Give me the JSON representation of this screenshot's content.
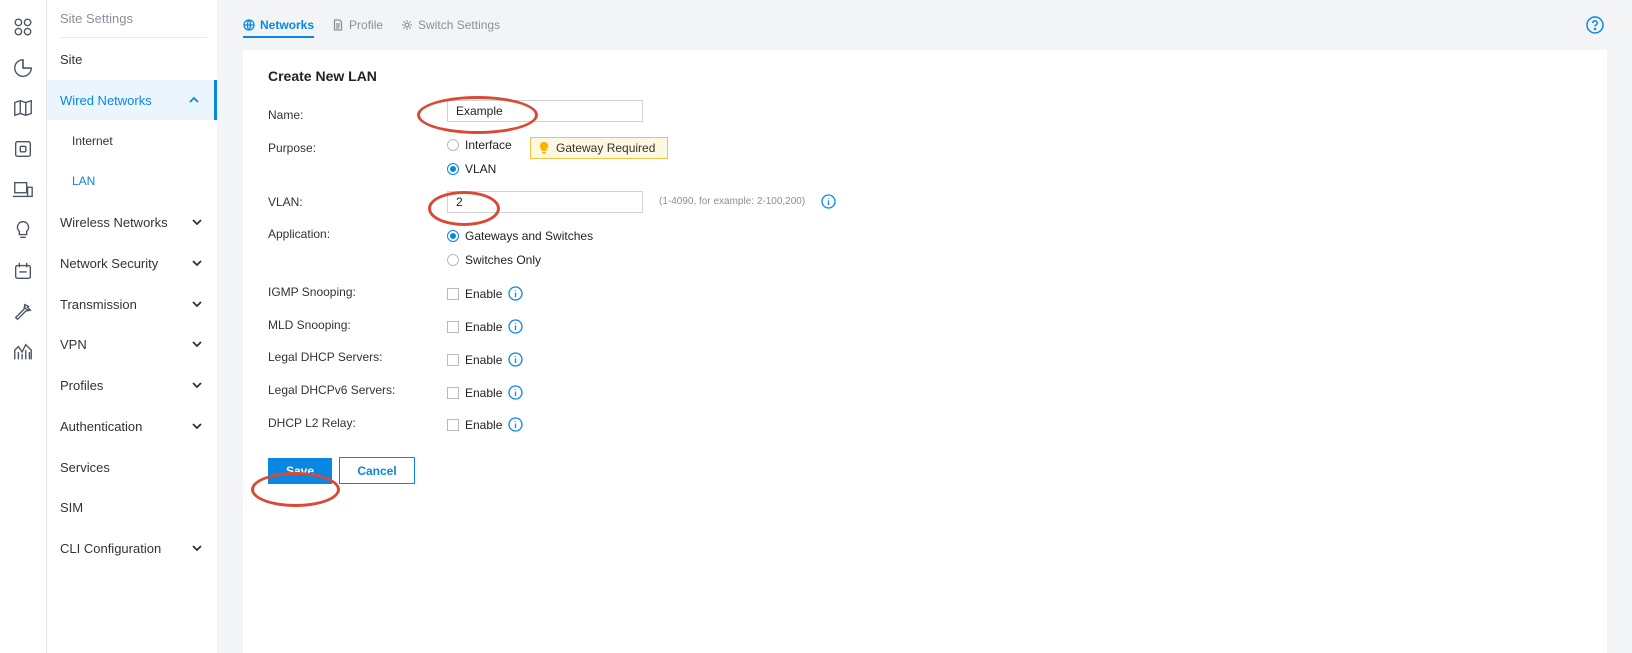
{
  "rail": {
    "icons": [
      "dashboard-icon",
      "statistics-icon",
      "map-icon",
      "devices-icon",
      "clients-icon",
      "insight-icon",
      "logs-icon",
      "tools-icon",
      "reports-icon"
    ]
  },
  "sidebar": {
    "header": "Site Settings",
    "items": [
      {
        "label": "Site"
      },
      {
        "label": "Wired Networks"
      },
      {
        "label": "Internet"
      },
      {
        "label": "LAN"
      },
      {
        "label": "Wireless Networks"
      },
      {
        "label": "Network Security"
      },
      {
        "label": "Transmission"
      },
      {
        "label": "VPN"
      },
      {
        "label": "Profiles"
      },
      {
        "label": "Authentication"
      },
      {
        "label": "Services"
      },
      {
        "label": "SIM"
      },
      {
        "label": "CLI Configuration"
      }
    ]
  },
  "tabs": [
    {
      "label": "Networks"
    },
    {
      "label": "Profile"
    },
    {
      "label": "Switch Settings"
    }
  ],
  "form": {
    "title": "Create New LAN",
    "name_label": "Name:",
    "name_value": "Example",
    "purpose_label": "Purpose:",
    "purpose_options": [
      "Interface",
      "VLAN"
    ],
    "purpose_selected": "VLAN",
    "gateway_badge": "Gateway Required",
    "vlan_label": "VLAN:",
    "vlan_value": "2",
    "vlan_hint": "(1-4090, for example: 2-100,200)",
    "application_label": "Application:",
    "application_options": [
      "Gateways and Switches",
      "Switches Only"
    ],
    "application_selected": "Gateways and Switches",
    "igmp_label": "IGMP Snooping:",
    "mld_label": "MLD Snooping:",
    "dhcp_label": "Legal DHCP Servers:",
    "dhcpv6_label": "Legal DHCPv6 Servers:",
    "relay_label": "DHCP L2 Relay:",
    "enable_text": "Enable",
    "save_label": "Save",
    "cancel_label": "Cancel"
  },
  "colors": {
    "accent": "#0a87e3",
    "annotation": "#d94a35",
    "badge_bg": "#fff8e1"
  }
}
